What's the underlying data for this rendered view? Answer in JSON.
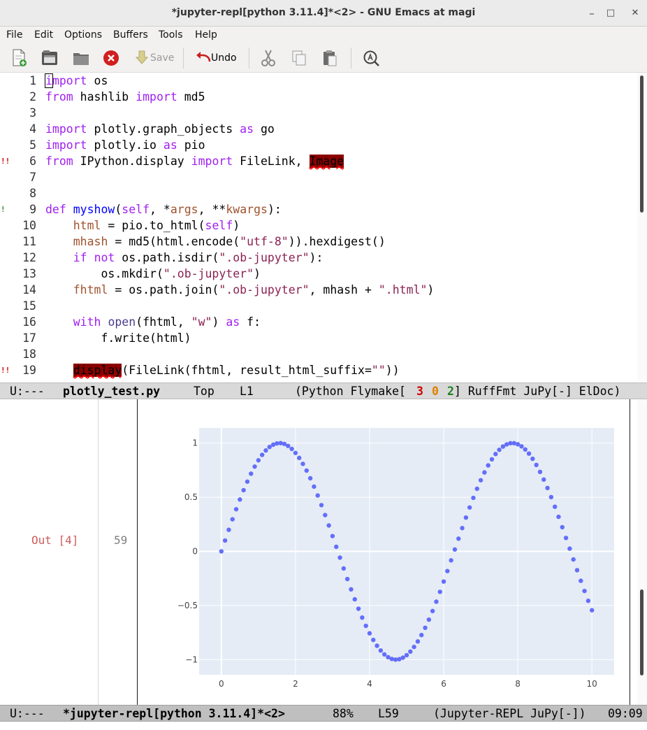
{
  "window": {
    "title": "*jupyter-repl[python 3.11.4]*<2> - GNU Emacs at magi",
    "controls": {
      "minimize": "–",
      "maximize": "□",
      "close": "✕"
    }
  },
  "menubar": [
    "File",
    "Edit",
    "Options",
    "Buffers",
    "Tools",
    "Help"
  ],
  "toolbar": {
    "save_label": "Save",
    "undo_label": "Undo",
    "icons": [
      "new-file-icon",
      "open-file-icon",
      "open-directory-icon",
      "close-buffer-icon",
      "save-icon",
      "undo-icon",
      "cut-icon",
      "copy-icon",
      "paste-icon",
      "search-icon"
    ]
  },
  "code": {
    "lines": [
      {
        "n": "1",
        "segments": [
          {
            "t": "import",
            "c": "kw cursor-first"
          },
          {
            "t": " os",
            "c": ""
          }
        ]
      },
      {
        "n": "2",
        "segments": [
          {
            "t": "from",
            "c": "kw"
          },
          {
            "t": " hashlib ",
            "c": ""
          },
          {
            "t": "import",
            "c": "kw"
          },
          {
            "t": " md5",
            "c": ""
          }
        ]
      },
      {
        "n": "3",
        "segments": []
      },
      {
        "n": "4",
        "segments": [
          {
            "t": "import",
            "c": "kw"
          },
          {
            "t": " plotly.graph_objects ",
            "c": ""
          },
          {
            "t": "as",
            "c": "kw"
          },
          {
            "t": " go",
            "c": ""
          }
        ]
      },
      {
        "n": "5",
        "segments": [
          {
            "t": "import",
            "c": "kw"
          },
          {
            "t": " plotly.io ",
            "c": ""
          },
          {
            "t": "as",
            "c": "kw"
          },
          {
            "t": " pio",
            "c": ""
          }
        ]
      },
      {
        "n": "6",
        "fringe": "!!",
        "fringe_color": "#d00000",
        "segments": [
          {
            "t": "from",
            "c": "kw"
          },
          {
            "t": " IPython.display ",
            "c": ""
          },
          {
            "t": "import",
            "c": "kw"
          },
          {
            "t": " FileLink, ",
            "c": ""
          },
          {
            "t": "Image",
            "c": "err"
          }
        ]
      },
      {
        "n": "7",
        "segments": []
      },
      {
        "n": "8",
        "segments": []
      },
      {
        "n": "9",
        "fringe": "!",
        "fringe_color": "#2e8b2e",
        "segments": [
          {
            "t": "def",
            "c": "kw"
          },
          {
            "t": " ",
            "c": ""
          },
          {
            "t": "myshow",
            "c": "fn"
          },
          {
            "t": "(",
            "c": ""
          },
          {
            "t": "self",
            "c": "kw"
          },
          {
            "t": ", *",
            "c": ""
          },
          {
            "t": "args",
            "c": "var"
          },
          {
            "t": ", **",
            "c": ""
          },
          {
            "t": "kwargs",
            "c": "var"
          },
          {
            "t": "):",
            "c": ""
          }
        ]
      },
      {
        "n": "10",
        "segments": [
          {
            "t": "    ",
            "c": ""
          },
          {
            "t": "html",
            "c": "var"
          },
          {
            "t": " = pio.to_html(",
            "c": ""
          },
          {
            "t": "self",
            "c": "kw"
          },
          {
            "t": ")",
            "c": ""
          }
        ]
      },
      {
        "n": "11",
        "segments": [
          {
            "t": "    ",
            "c": ""
          },
          {
            "t": "mhash",
            "c": "var"
          },
          {
            "t": " = md5(html.encode(",
            "c": ""
          },
          {
            "t": "\"utf-8\"",
            "c": "str"
          },
          {
            "t": ")).hexdigest()",
            "c": ""
          }
        ]
      },
      {
        "n": "12",
        "segments": [
          {
            "t": "    ",
            "c": ""
          },
          {
            "t": "if",
            "c": "kw"
          },
          {
            "t": " ",
            "c": ""
          },
          {
            "t": "not",
            "c": "kw"
          },
          {
            "t": " os.path.isdir(",
            "c": ""
          },
          {
            "t": "\".ob-jupyter\"",
            "c": "str"
          },
          {
            "t": "):",
            "c": ""
          }
        ]
      },
      {
        "n": "13",
        "segments": [
          {
            "t": "        os.mkdir(",
            "c": ""
          },
          {
            "t": "\".ob-jupyter\"",
            "c": "str"
          },
          {
            "t": ")",
            "c": ""
          }
        ]
      },
      {
        "n": "14",
        "segments": [
          {
            "t": "    ",
            "c": ""
          },
          {
            "t": "fhtml",
            "c": "var"
          },
          {
            "t": " = os.path.join(",
            "c": ""
          },
          {
            "t": "\".ob-jupyter\"",
            "c": "str"
          },
          {
            "t": ", mhash + ",
            "c": ""
          },
          {
            "t": "\".html\"",
            "c": "str"
          },
          {
            "t": ")",
            "c": ""
          }
        ]
      },
      {
        "n": "15",
        "segments": []
      },
      {
        "n": "16",
        "segments": [
          {
            "t": "    ",
            "c": ""
          },
          {
            "t": "with",
            "c": "kw"
          },
          {
            "t": " ",
            "c": ""
          },
          {
            "t": "open",
            "c": "bi"
          },
          {
            "t": "(fhtml, ",
            "c": ""
          },
          {
            "t": "\"w\"",
            "c": "str"
          },
          {
            "t": ") ",
            "c": ""
          },
          {
            "t": "as",
            "c": "kw"
          },
          {
            "t": " f:",
            "c": ""
          }
        ]
      },
      {
        "n": "17",
        "segments": [
          {
            "t": "        f.write(html)",
            "c": ""
          }
        ]
      },
      {
        "n": "18",
        "segments": []
      },
      {
        "n": "19",
        "fringe": "!!",
        "fringe_color": "#d00000",
        "segments": [
          {
            "t": "    ",
            "c": ""
          },
          {
            "t": "display",
            "c": "err"
          },
          {
            "t": "(FileLink(fhtml, result_html_suffix=",
            "c": ""
          },
          {
            "t": "\"\"",
            "c": "str"
          },
          {
            "t": "))",
            "c": ""
          }
        ]
      }
    ]
  },
  "modeline_code": {
    "status": "U:---",
    "buffer": "plotly_test.py",
    "position": "Top",
    "line": "L1",
    "mode_prefix": "(Python Flymake[",
    "err_count": "3",
    "warn_count": "0",
    "note_count": "2",
    "mode_suffix": "] RuffFmt JuPy[-] ElDoc)"
  },
  "repl": {
    "out_label": "Out [4]",
    "out_num": "59"
  },
  "modeline_repl": {
    "status": "U:---",
    "buffer": "*jupyter-repl[python 3.11.4]*<2>",
    "position": "88%",
    "line": "L59",
    "modes": "(Jupyter-REPL JuPy[-])",
    "time": "09:09"
  },
  "colors": {
    "err_count": "#d00000",
    "warn_count": "#e08000",
    "note_count": "#208020",
    "plot_marker": "#636efa",
    "plot_bg": "#e5ecf6"
  },
  "chart_data": {
    "type": "scatter",
    "x": [
      0.0,
      0.1,
      0.2,
      0.3,
      0.4,
      0.5,
      0.6,
      0.7,
      0.8,
      0.9,
      1.0,
      1.1,
      1.2,
      1.3,
      1.4,
      1.5,
      1.6,
      1.7,
      1.8,
      1.9,
      2.0,
      2.1,
      2.2,
      2.3,
      2.4,
      2.5,
      2.6,
      2.7,
      2.8,
      2.9,
      3.0,
      3.1,
      3.2,
      3.3,
      3.4,
      3.5,
      3.6,
      3.7,
      3.8,
      3.9,
      4.0,
      4.1,
      4.2,
      4.3,
      4.4,
      4.5,
      4.6,
      4.7,
      4.8,
      4.9,
      5.0,
      5.1,
      5.2,
      5.3,
      5.4,
      5.5,
      5.6,
      5.7,
      5.8,
      5.9,
      6.0,
      6.1,
      6.2,
      6.3,
      6.4,
      6.5,
      6.6,
      6.7,
      6.8,
      6.9,
      7.0,
      7.1,
      7.2,
      7.3,
      7.4,
      7.5,
      7.6,
      7.7,
      7.8,
      7.9,
      8.0,
      8.1,
      8.2,
      8.3,
      8.4,
      8.5,
      8.6,
      8.7,
      8.8,
      8.9,
      9.0,
      9.1,
      9.2,
      9.3,
      9.4,
      9.5,
      9.6,
      9.7,
      9.8,
      9.9,
      10.0
    ],
    "y": [
      0.0,
      0.1,
      0.199,
      0.296,
      0.389,
      0.479,
      0.565,
      0.644,
      0.717,
      0.783,
      0.841,
      0.891,
      0.932,
      0.964,
      0.985,
      0.997,
      1.0,
      0.992,
      0.974,
      0.946,
      0.909,
      0.863,
      0.808,
      0.746,
      0.675,
      0.598,
      0.516,
      0.427,
      0.335,
      0.239,
      0.141,
      0.042,
      -0.058,
      -0.158,
      -0.256,
      -0.351,
      -0.443,
      -0.53,
      -0.612,
      -0.688,
      -0.757,
      -0.818,
      -0.872,
      -0.916,
      -0.952,
      -0.978,
      -0.994,
      -1.0,
      -0.996,
      -0.982,
      -0.959,
      -0.926,
      -0.883,
      -0.832,
      -0.773,
      -0.706,
      -0.631,
      -0.551,
      -0.465,
      -0.374,
      -0.279,
      -0.182,
      -0.083,
      0.017,
      0.117,
      0.215,
      0.312,
      0.405,
      0.494,
      0.578,
      0.657,
      0.729,
      0.794,
      0.85,
      0.899,
      0.938,
      0.968,
      0.988,
      0.999,
      0.999,
      0.989,
      0.97,
      0.941,
      0.903,
      0.855,
      0.798,
      0.734,
      0.663,
      0.585,
      0.501,
      0.412,
      0.319,
      0.223,
      0.124,
      0.025,
      -0.075,
      -0.174,
      -0.272,
      -0.366,
      -0.457,
      -0.544
    ],
    "xticks": [
      "0",
      "2",
      "4",
      "6",
      "8",
      "10"
    ],
    "yticks": [
      "1",
      "0.5",
      "0",
      "−0.5",
      "−1"
    ],
    "xlim": [
      -0.6,
      10.6
    ],
    "ylim": [
      -1.14,
      1.14
    ],
    "grid": true,
    "title": "",
    "xlabel": "",
    "ylabel": ""
  }
}
